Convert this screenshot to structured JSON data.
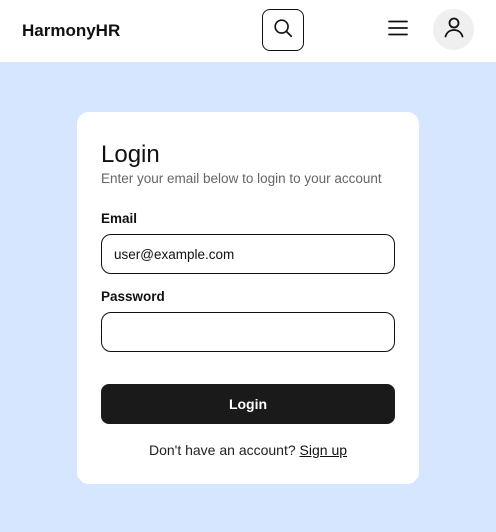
{
  "header": {
    "brand": "HarmonyHR",
    "icons": {
      "search": "search-icon",
      "menu": "hamburger-menu-icon",
      "user": "user-icon"
    }
  },
  "login_card": {
    "title": "Login",
    "subtitle": "Enter your email below to login to your account",
    "email": {
      "label": "Email",
      "value": "user@example.com"
    },
    "password": {
      "label": "Password",
      "value": ""
    },
    "submit_label": "Login",
    "signup_prompt": "Don't have an account?",
    "signup_link": "Sign up"
  },
  "colors": {
    "page_background": "#d7e6ff",
    "card_background": "#ffffff",
    "primary_button": "#1a1a1a",
    "header_background": "#ffffff"
  }
}
